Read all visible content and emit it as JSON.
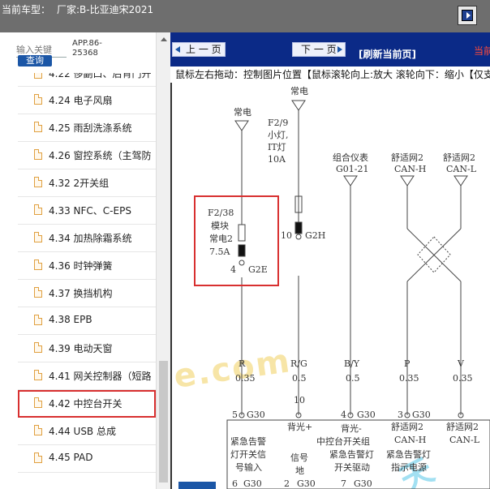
{
  "header": {
    "label": "当前车型：",
    "vehicle": "厂家:B-比亚迪宋2021"
  },
  "sidebar": {
    "search_placeholder": "输入关键",
    "query_label": "查询",
    "app_code": "APP.86-25368",
    "items": [
      {
        "label": "4.22 侈副口、后背门开"
      },
      {
        "label": "4.24 电子风扇"
      },
      {
        "label": "4.25 雨刮洗涤系统"
      },
      {
        "label": "4.26 窗控系统（主驾防"
      },
      {
        "label": "4.32 2开关组"
      },
      {
        "label": "4.33 NFC、C-EPS"
      },
      {
        "label": "4.34 加热除霜系统"
      },
      {
        "label": "4.36 时钟弹簧"
      },
      {
        "label": "4.37 换挡机构"
      },
      {
        "label": "4.38 EPB"
      },
      {
        "label": "4.39 电动天窗"
      },
      {
        "label": "4.41 网关控制器（短路"
      },
      {
        "label": "4.42 中控台开关",
        "selected": true
      },
      {
        "label": "4.44 USB 总成"
      },
      {
        "label": "4.45 PAD"
      }
    ]
  },
  "viewer": {
    "prev_label": "上 一 页",
    "next_label": "下 一 页",
    "refresh_label": "[刷新当前页]",
    "current_tag": "当前",
    "hint": "鼠标左右拖动：控制图片位置【鼠标滚轮向上:放大  滚轮向下：缩小【仅支"
  },
  "diagram": {
    "power1": "常电",
    "power2": "常电",
    "combo": "组合仪表",
    "combo_code": "G01-21",
    "can1_title": "舒适网2",
    "can1": "CAN-H",
    "can2_title": "舒适网2",
    "can2": "CAN-L",
    "fuse_small_1": "F2/9",
    "fuse_small_2": "小灯,",
    "fuse_small_3": "IT灯",
    "fuse_small_4": "10A",
    "fuse_small_pin": "10",
    "fuse_small_conn": "G2H",
    "fuse_main_1": "F2/38",
    "fuse_main_2": "模块",
    "fuse_main_3": "常电2",
    "fuse_main_4": "7.5A",
    "fuse_main_pin": "4",
    "fuse_main_conn": "G2E",
    "w1_color": "R",
    "w1_size": "0.35",
    "w2_color": "R/G",
    "w2_size": "0.5",
    "w3_color": "B/Y",
    "w3_size": "0.5",
    "w4_color": "P",
    "w4_size": "0.35",
    "w5_color": "V",
    "w5_size": "0.35",
    "pin_10": "10",
    "pin_5": "5",
    "pin_4": "4",
    "pin_3": "3",
    "conn": "G30",
    "box_1": "紧急告警",
    "box_1b": "灯开关信",
    "box_1c": "号输入",
    "box_2": "背光+",
    "box_2b": "信号",
    "box_2c": "地",
    "box_3": "背光-",
    "box_3b": "中控台开关组",
    "box_3c": "紧急告警灯",
    "box_3d": "开关驱动",
    "box_4": "舒适网2",
    "box_4b": "CAN-H",
    "box_4c": "紧急告警灯",
    "box_4d": "指示电源",
    "box_5": "舒适网2",
    "box_5b": "CAN-L",
    "bottom_pin_6": "6",
    "bottom_pin_2": "2",
    "bottom_pin_7": "7"
  },
  "watermark_text": "e.com",
  "watermark2_text": "天"
}
